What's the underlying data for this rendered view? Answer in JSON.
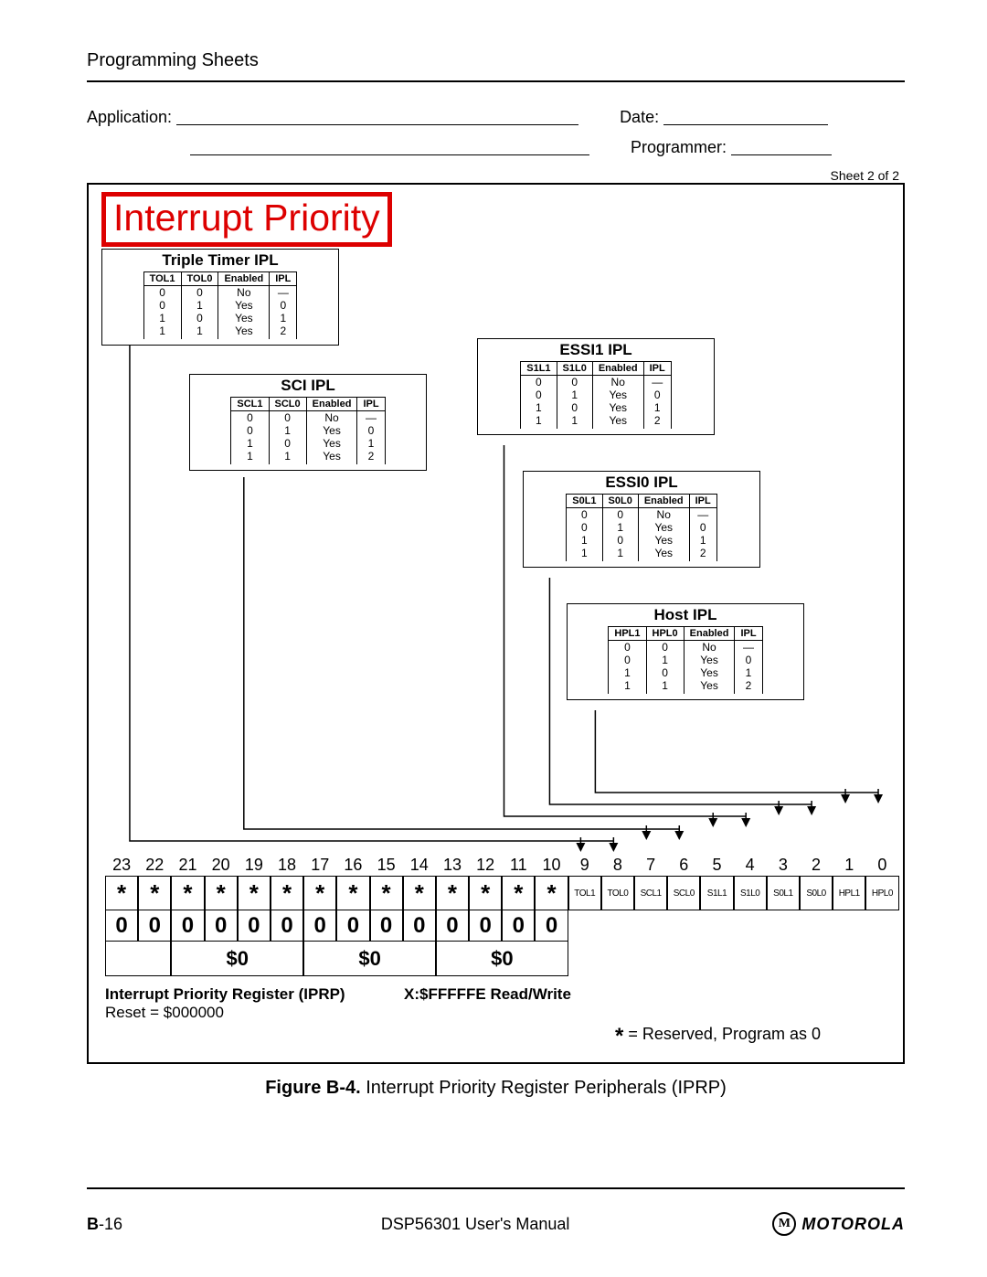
{
  "header": "Programming Sheets",
  "form": {
    "application": "Application:",
    "date": "Date:",
    "programmer": "Programmer:"
  },
  "sheet_note": "Sheet 2 of 2",
  "title_box": "Interrupt Priority",
  "tables": {
    "triple_timer": {
      "title": "Triple Timer IPL",
      "cols": [
        "TOL1",
        "TOL0",
        "Enabled",
        "IPL"
      ],
      "rows": [
        [
          "0",
          "0",
          "No",
          "—"
        ],
        [
          "0",
          "1",
          "Yes",
          "0"
        ],
        [
          "1",
          "0",
          "Yes",
          "1"
        ],
        [
          "1",
          "1",
          "Yes",
          "2"
        ]
      ]
    },
    "sci": {
      "title": "SCI IPL",
      "cols": [
        "SCL1",
        "SCL0",
        "Enabled",
        "IPL"
      ],
      "rows": [
        [
          "0",
          "0",
          "No",
          "—"
        ],
        [
          "0",
          "1",
          "Yes",
          "0"
        ],
        [
          "1",
          "0",
          "Yes",
          "1"
        ],
        [
          "1",
          "1",
          "Yes",
          "2"
        ]
      ]
    },
    "essi1": {
      "title": "ESSI1 IPL",
      "cols": [
        "S1L1",
        "S1L0",
        "Enabled",
        "IPL"
      ],
      "rows": [
        [
          "0",
          "0",
          "No",
          "—"
        ],
        [
          "0",
          "1",
          "Yes",
          "0"
        ],
        [
          "1",
          "0",
          "Yes",
          "1"
        ],
        [
          "1",
          "1",
          "Yes",
          "2"
        ]
      ]
    },
    "essi0": {
      "title": "ESSI0 IPL",
      "cols": [
        "S0L1",
        "S0L0",
        "Enabled",
        "IPL"
      ],
      "rows": [
        [
          "0",
          "0",
          "No",
          "—"
        ],
        [
          "0",
          "1",
          "Yes",
          "0"
        ],
        [
          "1",
          "0",
          "Yes",
          "1"
        ],
        [
          "1",
          "1",
          "Yes",
          "2"
        ]
      ]
    },
    "host": {
      "title": "Host IPL",
      "cols": [
        "HPL1",
        "HPL0",
        "Enabled",
        "IPL"
      ],
      "rows": [
        [
          "0",
          "0",
          "No",
          "—"
        ],
        [
          "0",
          "1",
          "Yes",
          "0"
        ],
        [
          "1",
          "0",
          "Yes",
          "1"
        ],
        [
          "1",
          "1",
          "Yes",
          "2"
        ]
      ]
    }
  },
  "register": {
    "bit_numbers": [
      "23",
      "22",
      "21",
      "20",
      "19",
      "18",
      "17",
      "16",
      "15",
      "14",
      "13",
      "12",
      "11",
      "10",
      "9",
      "8",
      "7",
      "6",
      "5",
      "4",
      "3",
      "2",
      "1",
      "0"
    ],
    "bit_names": [
      "*",
      "*",
      "*",
      "*",
      "*",
      "*",
      "*",
      "*",
      "*",
      "*",
      "*",
      "*",
      "*",
      "*",
      "TOL1",
      "TOL0",
      "SCL1",
      "SCL0",
      "S1L1",
      "S1L0",
      "S0L1",
      "S0L0",
      "HPL1",
      "HPL0"
    ],
    "values": [
      "0",
      "0",
      "0",
      "0",
      "0",
      "0",
      "0",
      "0",
      "0",
      "0",
      "0",
      "0",
      "0",
      "0"
    ],
    "hex": [
      "$0",
      "$0",
      "$0"
    ],
    "label": "Interrupt Priority Register (IPRP)",
    "addr": "X:$FFFFFE Read/Write",
    "reset": "Reset = $000000"
  },
  "footnote": {
    "star": "*",
    "text": " = Reserved, Program as 0"
  },
  "caption": {
    "fig": "Figure B-4.",
    "text": " Interrupt Priority Register Peripherals (IPRP)"
  },
  "footer": {
    "page_prefix": "B",
    "page_num": "-16",
    "manual": "DSP56301 User's Manual",
    "brand": "MOTOROLA"
  }
}
